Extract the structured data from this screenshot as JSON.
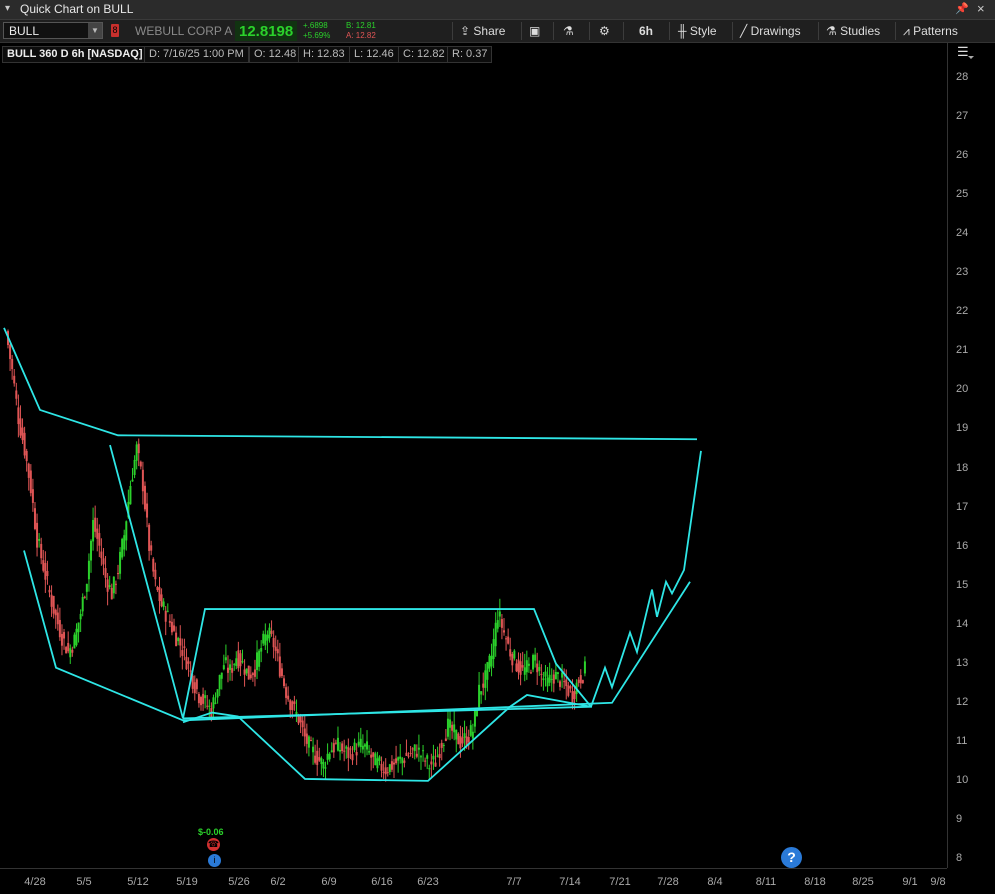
{
  "window": {
    "title": "Quick Chart on BULL"
  },
  "toolbar": {
    "symbol": "BULL",
    "company": "WEBULL CORP A",
    "last_price": "12.8198",
    "net_change": "+.6898",
    "pct_change": "+5.69%",
    "bid": "B: 12.81",
    "ask": "A: 12.82",
    "share_label": "Share",
    "timeframe": "6h",
    "style_label": "Style",
    "drawings_label": "Drawings",
    "studies_label": "Studies",
    "patterns_label": "Patterns"
  },
  "infobar": {
    "symbol_desc": "BULL 360 D 6h [NASDAQ]",
    "date": "D: 7/16/25 1:00 PM",
    "open": "O: 12.48",
    "high": "H: 12.83",
    "low": "L: 12.46",
    "close": "C: 12.82",
    "range": "R: 0.37"
  },
  "events": {
    "dividend_label": "$-0.06",
    "earnings_icon": "earnings-icon",
    "info_icon": "info-icon"
  },
  "colors": {
    "up": "#2bd12b",
    "down": "#e05555",
    "drawing": "#2ee6e6",
    "background": "#000000"
  },
  "chart_data": {
    "type": "candlestick",
    "y_axis": {
      "min": 8,
      "max": 28,
      "ticks": [
        8,
        9,
        10,
        11,
        12,
        13,
        14,
        15,
        16,
        17,
        18,
        19,
        20,
        21,
        22,
        23,
        24,
        25,
        26,
        27,
        28
      ]
    },
    "x_axis": {
      "tick_labels": [
        "4/28",
        "5/5",
        "5/12",
        "5/19",
        "5/26",
        "6/2",
        "6/9",
        "6/16",
        "6/23",
        "7/7",
        "7/14",
        "7/21",
        "7/28",
        "8/4",
        "8/11",
        "8/18",
        "8/25",
        "9/1",
        "9/8"
      ]
    },
    "price_path": [
      [
        0,
        21.5
      ],
      [
        1,
        20.5
      ],
      [
        2,
        19.3
      ],
      [
        3,
        18.5
      ],
      [
        4,
        17.5
      ],
      [
        5,
        16.2
      ],
      [
        6,
        15.5
      ],
      [
        7,
        14.8
      ],
      [
        8,
        14.2
      ],
      [
        9,
        13.7
      ],
      [
        10,
        13.3
      ],
      [
        11,
        13.6
      ],
      [
        12,
        14.3
      ],
      [
        13,
        15.2
      ],
      [
        14,
        16.6
      ],
      [
        15,
        16.0
      ],
      [
        16,
        15.2
      ],
      [
        17,
        14.8
      ],
      [
        18,
        15.4
      ],
      [
        19,
        16.3
      ],
      [
        20,
        17.6
      ],
      [
        21,
        18.5
      ],
      [
        22,
        17.6
      ],
      [
        23,
        16.0
      ],
      [
        24,
        15.0
      ],
      [
        25,
        14.5
      ],
      [
        26,
        14.2
      ],
      [
        27,
        13.8
      ],
      [
        28,
        13.5
      ],
      [
        29,
        13.1
      ],
      [
        30,
        12.6
      ],
      [
        31,
        12.2
      ],
      [
        32,
        12.0
      ],
      [
        33,
        11.8
      ],
      [
        34,
        12.4
      ],
      [
        35,
        13.0
      ],
      [
        36,
        12.8
      ],
      [
        37,
        13.2
      ],
      [
        38,
        13.0
      ],
      [
        39,
        12.7
      ],
      [
        40,
        12.9
      ],
      [
        41,
        13.4
      ],
      [
        42,
        13.8
      ],
      [
        43,
        13.5
      ],
      [
        44,
        12.9
      ],
      [
        45,
        12.3
      ],
      [
        46,
        11.9
      ],
      [
        47,
        11.6
      ],
      [
        48,
        11.1
      ],
      [
        49,
        10.8
      ],
      [
        50,
        10.6
      ],
      [
        51,
        10.4
      ],
      [
        52,
        10.8
      ],
      [
        53,
        10.9
      ],
      [
        54,
        10.8
      ],
      [
        55,
        10.7
      ],
      [
        56,
        10.8
      ],
      [
        57,
        10.9
      ],
      [
        58,
        10.8
      ],
      [
        59,
        10.5
      ],
      [
        60,
        10.4
      ],
      [
        61,
        10.3
      ],
      [
        62,
        10.4
      ],
      [
        63,
        10.5
      ],
      [
        64,
        10.6
      ],
      [
        65,
        10.7
      ],
      [
        66,
        10.8
      ],
      [
        67,
        10.6
      ],
      [
        68,
        10.4
      ],
      [
        69,
        10.5
      ],
      [
        70,
        11.0
      ],
      [
        71,
        11.4
      ],
      [
        72,
        11.2
      ],
      [
        73,
        11.0
      ],
      [
        74,
        11.1
      ],
      [
        75,
        11.3
      ],
      [
        76,
        12.3
      ],
      [
        77,
        12.6
      ],
      [
        78,
        13.2
      ],
      [
        79,
        14.3
      ],
      [
        80,
        13.8
      ],
      [
        81,
        13.3
      ],
      [
        82,
        13.0
      ],
      [
        83,
        12.8
      ],
      [
        84,
        12.9
      ],
      [
        85,
        13.1
      ],
      [
        86,
        12.7
      ],
      [
        87,
        12.5
      ],
      [
        88,
        12.7
      ],
      [
        89,
        12.6
      ],
      [
        90,
        12.4
      ],
      [
        91,
        12.2
      ],
      [
        92,
        12.6
      ],
      [
        93,
        12.82
      ]
    ],
    "drawings": [
      {
        "points": [
          [
            4,
            "4/24",
            21.6
          ],
          [
            40,
            "",
            19.5
          ],
          [
            118,
            "",
            18.85
          ],
          [
            697,
            "",
            18.75
          ]
        ]
      },
      {
        "points": [
          [
            24,
            "",
            15.9
          ],
          [
            56,
            "",
            12.9
          ],
          [
            183,
            "",
            11.55
          ],
          [
            612,
            "",
            12.0
          ],
          [
            690,
            "",
            15.1
          ]
        ]
      },
      {
        "points": [
          [
            110,
            "",
            18.6
          ],
          [
            183,
            "",
            11.6
          ],
          [
            205,
            "",
            14.4
          ],
          [
            534,
            "",
            14.4
          ],
          [
            556,
            "",
            13.0
          ],
          [
            591,
            "",
            11.9
          ]
        ]
      },
      {
        "points": [
          [
            183,
            "",
            11.6
          ],
          [
            592,
            "",
            11.9
          ]
        ]
      },
      {
        "points": [
          [
            183,
            "",
            11.5
          ],
          [
            212,
            "",
            11.75
          ],
          [
            238,
            "",
            11.65
          ],
          [
            305,
            "",
            10.05
          ],
          [
            428,
            "",
            10.0
          ],
          [
            510,
            "",
            11.9
          ],
          [
            527,
            "",
            12.2
          ],
          [
            591,
            "",
            11.9
          ]
        ]
      },
      {
        "points": [
          [
            591,
            "",
            11.9
          ],
          [
            605,
            "",
            12.9
          ],
          [
            612,
            "",
            12.4
          ],
          [
            630,
            "",
            13.8
          ],
          [
            637,
            "",
            13.3
          ],
          [
            652,
            "",
            14.9
          ],
          [
            657,
            "",
            14.2
          ],
          [
            666,
            "",
            15.1
          ],
          [
            672,
            "",
            14.8
          ],
          [
            684,
            "",
            15.4
          ],
          [
            701,
            "",
            18.45
          ]
        ]
      }
    ]
  }
}
